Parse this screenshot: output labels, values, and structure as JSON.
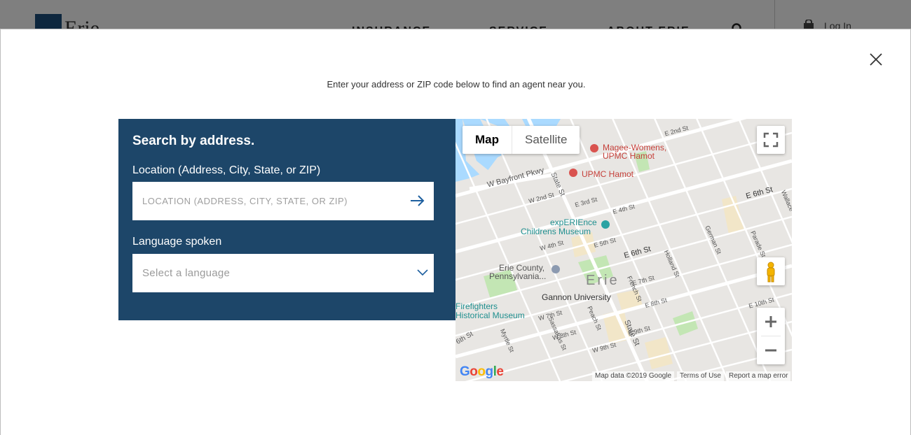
{
  "background": {
    "logo_text": "Erie",
    "nav": [
      "INSURANCE",
      "SERVICE",
      "ABOUT ERIE"
    ],
    "login_label": "Log In"
  },
  "modal": {
    "intro": "Enter your address or ZIP code below to find an agent near you.",
    "search_panel": {
      "title": "Search by address.",
      "location_label": "Location (Address, City, State, or ZIP)",
      "location_placeholder": "LOCATION (ADDRESS, CITY, STATE, OR ZIP)",
      "location_value": "",
      "language_label": "Language spoken",
      "language_selected": "Select a language"
    },
    "map": {
      "type_map": "Map",
      "type_satellite": "Satellite",
      "places": {
        "magee_1": "Magee-Womens,",
        "magee_2": "UPMC Hamot",
        "hamot": "UPMC Hamot",
        "experience_1": "expERIEnce",
        "experience_2": "Childrens Museum",
        "county_1": "Erie County,",
        "county_2": "Pennsylvania...",
        "city": "Erie",
        "gannon": "Gannon University",
        "firefighters_1": "Firefighters",
        "firefighters_2": "Historical Museum"
      },
      "streets": {
        "bayfront": "W Bayfront Pkwy",
        "state_st": "State St",
        "state_st_2": "State St",
        "e6th": "E 6th St",
        "e6th_2": "E 6th St",
        "w4th": "W 4th St",
        "e5th": "E 5th St",
        "e4th": "E 4th St",
        "e3rd": "E 3rd St",
        "e2nd": "E 2nd St",
        "w2nd": "W 2nd St",
        "e7th": "E 7th St",
        "e8th": "E 8th St",
        "e10th": "E 10th St",
        "w7th": "W 7th St",
        "w8th": "W 8th St",
        "w9th": "W 9th St",
        "e9th": "E 9th St",
        "french": "French St",
        "holland": "Holland St",
        "german": "German St",
        "parade": "Parade St",
        "peach": "Peach St",
        "sassafras": "Sassafras St",
        "myrtle": "Myrtle St",
        "sixth": "6th St",
        "wallace": "Wallace"
      },
      "google": "Google",
      "map_data": "Map data ©2019 Google",
      "terms": "Terms of Use",
      "report": "Report a map error"
    }
  },
  "colors": {
    "panel": "#1d4669",
    "arrow": "#1d5f9f",
    "map_bg": "#e8e6e3",
    "hospital": "#d9534f",
    "museum_teal": "#2aa3a3"
  }
}
